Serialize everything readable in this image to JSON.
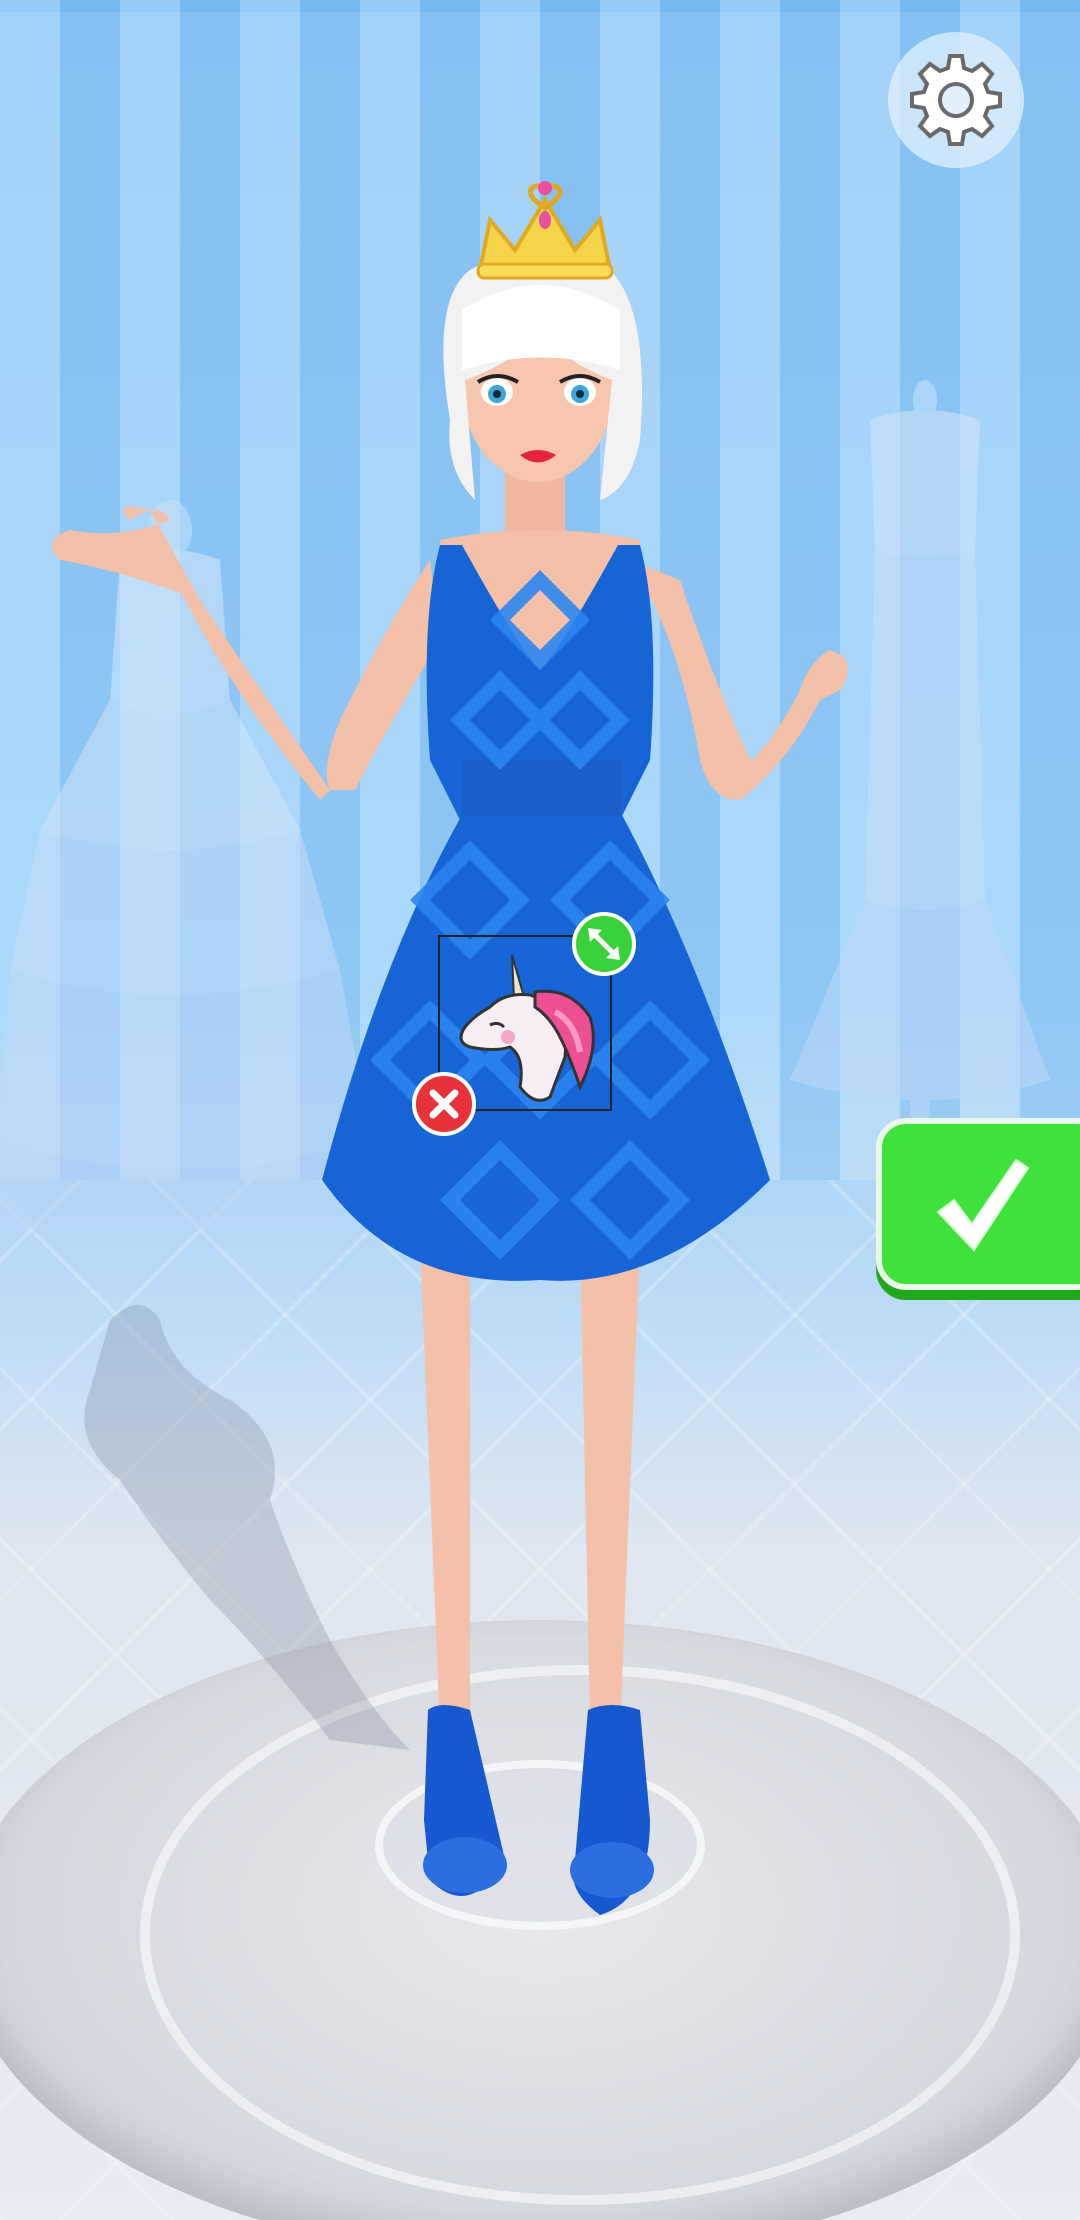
{
  "scene": {
    "name": "dress-up-stage",
    "background_color": "#8fc8f7",
    "floor_color": "#e9ecf2"
  },
  "character": {
    "hair_color": "#f2f2f2",
    "dress_color": "#1664d6",
    "dress_pattern_color": "#2b85ef",
    "shoe_color": "#1658d0",
    "accessory": "crown-icon"
  },
  "sticker": {
    "icon": "unicorn-icon",
    "mane_color": "#ec4f92"
  },
  "controls": {
    "settings_icon": "gear-icon",
    "confirm_icon": "checkmark-icon",
    "resize_icon": "resize-arrows-icon",
    "delete_icon": "close-icon",
    "confirm_color": "#3ee23a",
    "delete_color": "#e8323a",
    "resize_color": "#39d23a"
  }
}
